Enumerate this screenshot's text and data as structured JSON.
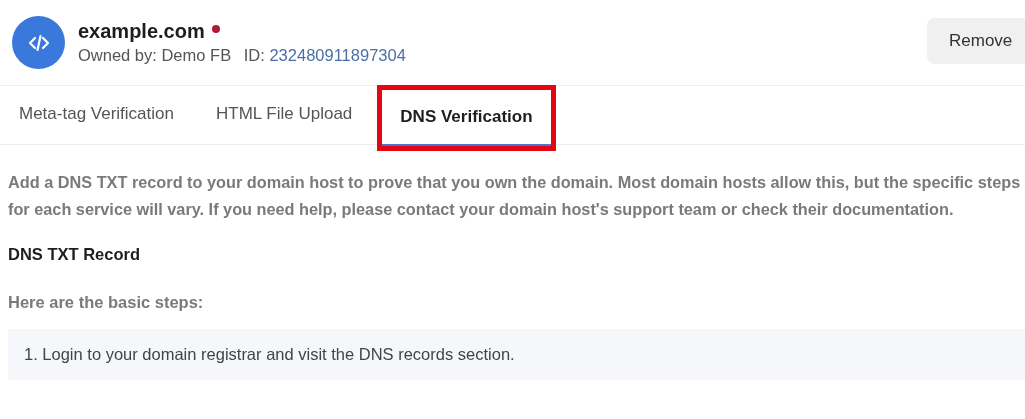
{
  "domain": {
    "name": "example.com",
    "status_dot": {
      "color": "#b0183c"
    },
    "owner": "Owned by: Demo FB",
    "id_label": "ID:",
    "id": "232480911897304"
  },
  "remove_button": "Remove",
  "tabs": [
    {
      "label": "Meta-tag Verification",
      "selected": false,
      "highlighted": false
    },
    {
      "label": "HTML File Upload",
      "selected": false,
      "highlighted": false
    },
    {
      "label": "DNS Verification",
      "selected": true,
      "highlighted": true
    }
  ],
  "description": "Add a DNS TXT record to your domain host to prove that you own the domain. Most domain hosts allow this, but the specific steps for each service will vary. If you need help, please contact your domain host's support team or check their documentation.",
  "section_title": "DNS TXT Record",
  "steps_intro": "Here are the basic steps:",
  "steps": [
    "1. Login to your domain registrar and visit the DNS records section."
  ]
}
